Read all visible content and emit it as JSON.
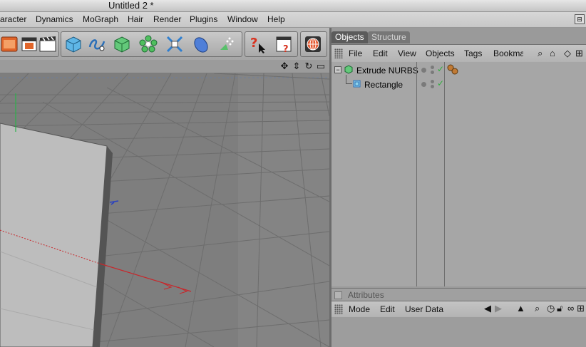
{
  "window": {
    "title": "Untitled 2 *"
  },
  "menu": [
    "aracter",
    "Dynamics",
    "MoGraph",
    "Hair",
    "Render",
    "Plugins",
    "Window",
    "Help"
  ],
  "toolbar": {
    "icons": [
      "render-view-icon",
      "render-settings-icon",
      "clapboard-icon",
      "cube-icon",
      "spline-pen-icon",
      "nurbs-icon",
      "array-icon",
      "deformer-icon",
      "environment-icon",
      "camera-light-icon",
      "help-cursor-icon",
      "layout-icon",
      "globe-icon"
    ]
  },
  "viewport": {
    "nav_icons": [
      "move-view-icon",
      "zoom-view-icon",
      "rotate-view-icon",
      "maximize-view-icon"
    ]
  },
  "object_manager": {
    "tabs": [
      "Objects",
      "Structure"
    ],
    "menu": [
      "File",
      "Edit",
      "View",
      "Objects",
      "Tags",
      "Bookma"
    ],
    "objects": [
      {
        "name": "Extrude NURBS",
        "icon": "extrude-nurbs-icon",
        "tag": "phong-tag-icon"
      },
      {
        "name": "Rectangle",
        "icon": "rectangle-spline-icon"
      }
    ]
  },
  "attributes": {
    "title": "Attributes",
    "menu": [
      "Mode",
      "Edit",
      "User Data"
    ]
  },
  "colors": {
    "active_tab": "#5b5b5b",
    "grid": "#6e6e6e",
    "x_axis": "#c8262a",
    "y_axis": "#2bb34a",
    "z_axis": "#2840c0"
  }
}
